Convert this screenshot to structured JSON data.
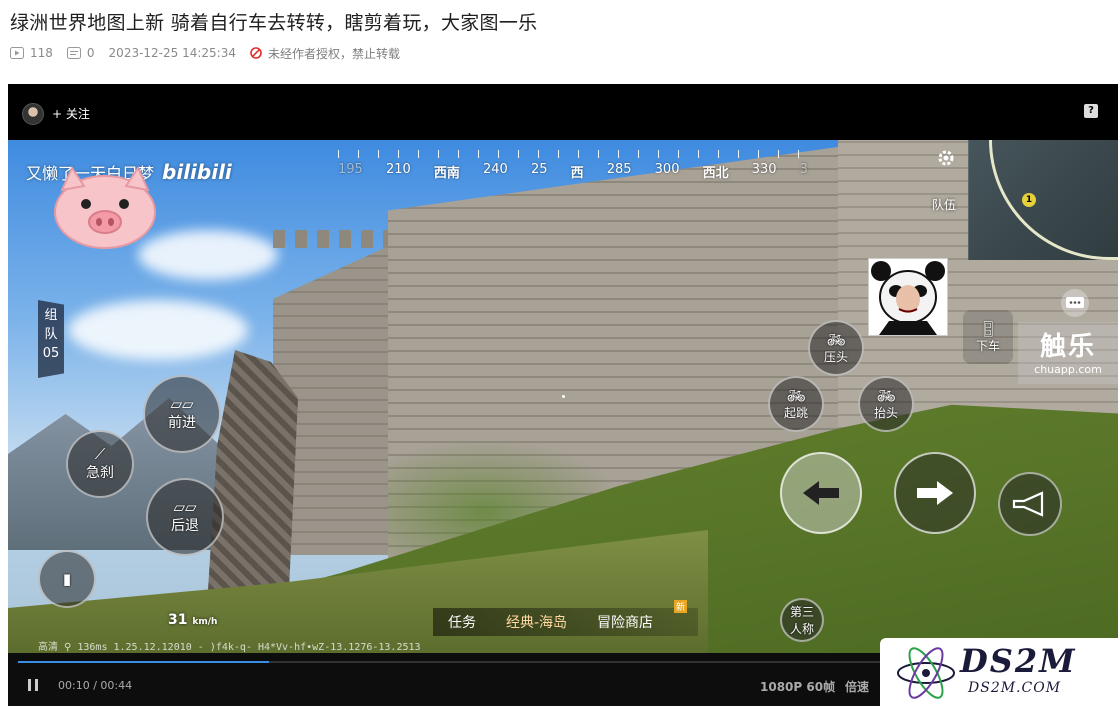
{
  "header": {
    "title": "绿洲世界地图上新 骑着自行车去转转，瞎剪着玩，大家图一乐",
    "views": "118",
    "comments": "0",
    "timestamp": "2023-12-25 14:25:34",
    "rights_notice": "未经作者授权，禁止转载"
  },
  "player": {
    "follow_label": "+ 关注",
    "help_label": "?",
    "current_time": "00:10",
    "duration": "00:44",
    "time_display": "00:10 / 00:44",
    "quality": "1080P 60帧",
    "speed": "倍速",
    "progress": 0.23
  },
  "game_hud": {
    "bili_text": "又懒了一天白日梦",
    "bili_logo": "bilibili",
    "compass": [
      "195",
      "210",
      "西南",
      "240",
      "25",
      "西",
      "285",
      "300",
      "西北",
      "330",
      "3"
    ],
    "team_panel": "组队05",
    "team_lines": [
      "组",
      "队",
      "05"
    ],
    "buttons": {
      "forward": "前进",
      "brake": "急刹",
      "backward": "后退",
      "press_head": "压头",
      "jump": "起跳",
      "lift_head": "抬头",
      "get_off": "下车",
      "team": "队伍",
      "third_person": "第三人称",
      "third_person_lines": [
        "第三",
        "人称"
      ]
    },
    "speed_value": "31",
    "speed_unit": "km/h",
    "tabs": [
      "任务",
      "经典-海岛",
      "冒险商店"
    ],
    "new_tag": "新",
    "status_line": "高清 ⚲ 136ms 1.25.12.12010 - )f4k-q- H4*Vv-hf•wZ-13.1276-13.2513",
    "marker_label": "1"
  },
  "watermarks": {
    "chule_big": "触乐",
    "chule_small": "chuapp.com",
    "site_main": "DS2M",
    "site_sub": "DS2M.COM"
  },
  "icons": [
    "play-count-icon",
    "comment-icon",
    "no-repost-icon",
    "pause-icon",
    "help-icon",
    "settings-icon",
    "chat-icon"
  ],
  "colors": {
    "progress": "#3a8ee6",
    "warning": "#e02e2e",
    "new_tag": "#e8a623"
  }
}
